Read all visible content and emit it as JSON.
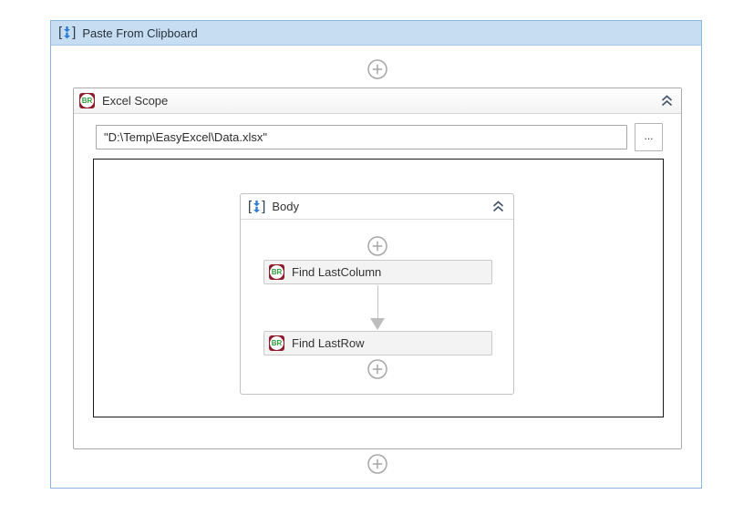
{
  "paste_from_clipboard": {
    "title": "Paste From Clipboard",
    "header_bg": "#c7ddf2",
    "border_color": "#8ab5dc"
  },
  "excel_scope": {
    "title": "Excel Scope",
    "file_path_value": "\"D:\\Temp\\EasyExcel\\Data.xlsx\"",
    "browse_button_label": "..."
  },
  "body_sequence": {
    "title": "Body",
    "activities": [
      {
        "label": "Find LastColumn"
      },
      {
        "label": "Find LastRow"
      }
    ]
  },
  "icons": {
    "br_badge_label": "BR",
    "br_badge_bg": "#8e1b2c",
    "br_badge_text_color": "#2fa03c",
    "sequence_arrow_color": "#2b7cd3",
    "collapse_chevron_color": "#44546a",
    "add_plus_color": "#a6a6a6",
    "connector_arrow_color": "#bdbdbd"
  }
}
